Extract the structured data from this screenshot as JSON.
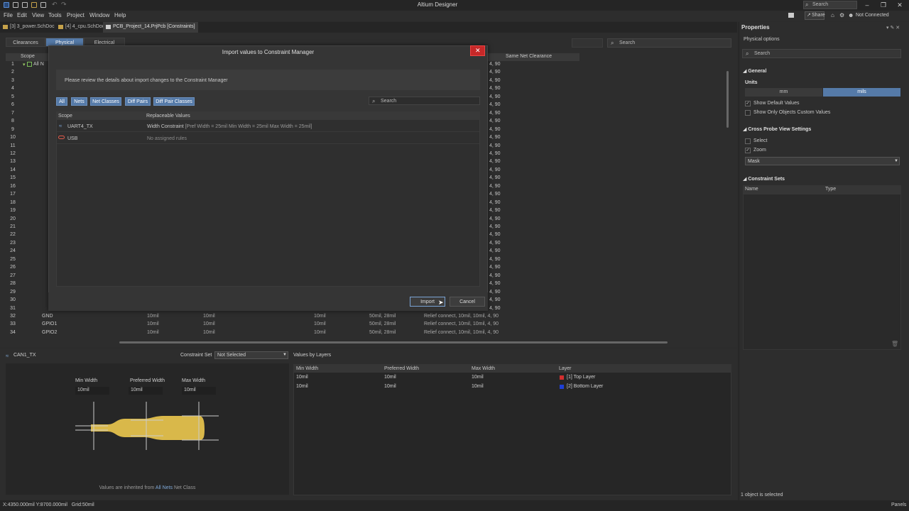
{
  "window": {
    "title": "Altium Designer",
    "search_placeholder": "Search"
  },
  "menubar": {
    "items": [
      "File",
      "Edit",
      "View",
      "Tools",
      "Project",
      "Window",
      "Help"
    ],
    "share": "Share",
    "connection": "Not Connected"
  },
  "doc_tabs": [
    {
      "label": "[3] 3_power.SchDoc"
    },
    {
      "label": "[4] 4_cpu.SchDoc"
    },
    {
      "label": "PCB_Project_14.PrjPcb [Constraints]"
    }
  ],
  "cm": {
    "tabs": [
      "Clearances",
      "Physical",
      "Electrical"
    ],
    "active_tab": "Physical",
    "search_placeholder": "Search",
    "columns": {
      "scope": "Scope",
      "same_net": "Same Net Clearance"
    },
    "row_numbers": [
      "1",
      "2",
      "3",
      "4",
      "5",
      "6",
      "7",
      "8",
      "9",
      "10",
      "11",
      "12",
      "13",
      "14",
      "15",
      "16",
      "17",
      "18",
      "19",
      "20",
      "21",
      "22",
      "23",
      "24",
      "25",
      "26",
      "27",
      "28",
      "29",
      "30",
      "31",
      "32",
      "33",
      "34"
    ],
    "row_tail": "4, 90",
    "first_row_name": "All N",
    "visible_rows": [
      {
        "num": "32",
        "name": "GND",
        "w1": "10mil",
        "w2": "10mil",
        "w3": "10mil",
        "via": "50mil, 28mil",
        "relief": "Relief connect, 10mil, 10mil, 4, 90"
      },
      {
        "num": "33",
        "name": "GPIO1",
        "w1": "10mil",
        "w2": "10mil",
        "w3": "10mil",
        "via": "50mil, 28mil",
        "relief": "Relief connect, 10mil, 10mil, 4, 90"
      },
      {
        "num": "34",
        "name": "GPIO2",
        "w1": "10mil",
        "w2": "10mil",
        "w3": "10mil",
        "via": "50mil, 28mil",
        "relief": "Relief connect, 10mil, 10mil, 4, 90"
      }
    ]
  },
  "detail": {
    "net_name": "CAN1_TX",
    "constraint_set_label": "Constraint Set",
    "constraint_set_value": "Not Selected",
    "min_width_label": "Min Width",
    "pref_width_label": "Preferred Width",
    "max_width_label": "Max Width",
    "min_width": "10mil",
    "pref_width": "10mil",
    "max_width": "10mil",
    "inherit_prefix": "Values are inherited from",
    "inherit_link": "All Nets",
    "inherit_suffix": "Net Class",
    "trace_color": "#d9b84a"
  },
  "values_by_layers": {
    "title": "Values by Layers",
    "headers": [
      "Min Width",
      "Preferred Width",
      "Max Width",
      "Layer"
    ],
    "rows": [
      {
        "min": "10mil",
        "pref": "10mil",
        "max": "10mil",
        "layer": "[1] Top Layer",
        "color": "#d32f2f"
      },
      {
        "min": "10mil",
        "pref": "10mil",
        "max": "10mil",
        "layer": "[2] Bottom Layer",
        "color": "#1e3fd6"
      }
    ]
  },
  "properties": {
    "title": "Properties",
    "subtitle": "Physical options",
    "search_placeholder": "Search",
    "general": "General",
    "units_label": "Units",
    "units": [
      "mm",
      "mils"
    ],
    "active_unit": "mils",
    "show_default": "Show Default Values",
    "show_custom": "Show Only Objects Custom Values",
    "cross_probe": "Cross Probe View Settings",
    "select": "Select",
    "zoom": "Zoom",
    "mask": "Mask",
    "constraint_sets": "Constraint Sets",
    "cs_columns": [
      "Name",
      "Type"
    ],
    "selected_count": "1 object is selected"
  },
  "status": {
    "coords": "X:4350.000mil Y:8700.000mil",
    "grid": "Grid:50mil",
    "panels": "Panels"
  },
  "dialog": {
    "title": "Import values to Constraint Manager",
    "info": "Please review the details about import changes to the Constraint Manager",
    "filters": [
      "All",
      "Nets",
      "Net Classes",
      "Diff Pairs",
      "Diff Pair Classes"
    ],
    "search_placeholder": "Search",
    "headers": [
      "Scope",
      "Replaceable Values"
    ],
    "rows": [
      {
        "scope": "UART4_TX",
        "value": "Width Constraint",
        "detail": "[Pref Width = 25mil    Min Width = 25mil    Max Width = 25mil]"
      },
      {
        "scope": "USB",
        "value": "",
        "detail": "No assigned rules"
      }
    ],
    "import": "Import",
    "cancel": "Cancel"
  }
}
